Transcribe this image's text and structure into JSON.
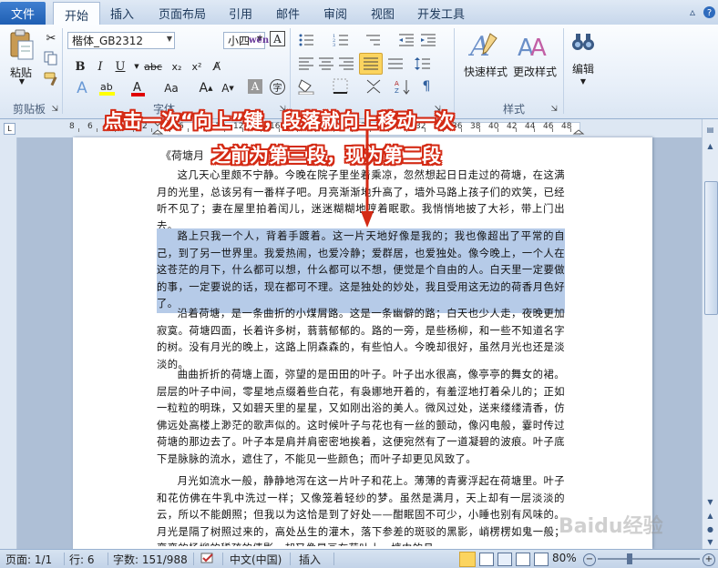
{
  "tabs": {
    "file": "文件",
    "items": [
      "开始",
      "插入",
      "页面布局",
      "引用",
      "邮件",
      "审阅",
      "视图",
      "开发工具"
    ],
    "active": 0
  },
  "ribbon": {
    "clipboard": {
      "paste": "粘贴",
      "label": "剪贴板"
    },
    "font": {
      "name": "楷体_GB2312",
      "size": "小四",
      "label": "字体"
    },
    "styles": {
      "quick": "快速样式",
      "change": "更改样式",
      "label": "样式"
    },
    "editing": {
      "label": "编辑"
    }
  },
  "annotation": {
    "line1": "点击一次“向上”键，段落就向上移动一次",
    "line2": "之前为第三段，现为第二段",
    "color": "#d42a14"
  },
  "ruler_numbers": [
    "8",
    "6",
    "4",
    "2",
    "2",
    "4",
    "6",
    "8",
    "10",
    "12",
    "14",
    "16",
    "18",
    "20",
    "22",
    "24",
    "26",
    "28",
    "30",
    "32",
    "34",
    "36",
    "38",
    "40",
    "42",
    "44",
    "46",
    "48"
  ],
  "document": {
    "title": "《荷塘月",
    "paragraphs": [
      {
        "text": "这几天心里颇不宁静。今晚在院子里坐着乘凉，忽然想起日日走过的荷塘，在这满月的光里，总该另有一番样子吧。月亮渐渐地升高了，墙外马路上孩子们的欢笑，已经听不见了；妻在屋里拍着闰儿，迷迷糊糊地哼着眠歌。我悄悄地披了大衫，带上门出去。"
      },
      {
        "text": "路上只我一个人，背着手踱着。这一片天地好像是我的；我也像超出了平常的自己，到了另一世界里。我爱热闹，也爱冷静；爱群居，也爱独处。像今晚上，一个人在这苍茫的月下，什么都可以想，什么都可以不想，便觉是个自由的人。白天里一定要做的事，一定要说的话，现在都可不理。这是独处的妙处，我且受用这无边的荷香月色好了。"
      },
      {
        "text": "沿着荷塘，是一条曲折的小煤屑路。这是一条幽僻的路；白天也少人走，夜晚更加寂寞。荷塘四面，长着许多树，蓊蓊郁郁的。路的一旁，是些杨柳，和一些不知道名字的树。没有月光的晚上，这路上阴森森的，有些怕人。今晚却很好，虽然月光也还是淡淡的。"
      },
      {
        "text": "曲曲折折的荷塘上面，弥望的是田田的叶子。叶子出水很高，像亭亭的舞女的裙。层层的叶子中间，零星地点缀着些白花，有袅娜地开着的，有羞涩地打着朵儿的；正如一粒粒的明珠，又如碧天里的星星，又如刚出浴的美人。微风过处，送来缕缕清香，仿佛远处高楼上渺茫的歌声似的。这时候叶子与花也有一丝的颤动，像闪电般，霎时传过荷塘的那边去了。叶子本是肩并肩密密地挨着，这便宛然有了一道凝碧的波痕。叶子底下是脉脉的流水，遮住了，不能见一些颜色；而叶子却更见风致了。"
      },
      {
        "text": "月光如流水一般，静静地泻在这一片叶子和花上。薄薄的青雾浮起在荷塘里。叶子和花仿佛在牛乳中洗过一样；又像笼着轻纱的梦。虽然是满月，天上却有一层淡淡的云，所以不能朗照；但我以为这恰是到了好处——酣眠固不可少，小睡也别有风味的。月光是隔了树照过来的，高处丛生的灌木，落下参差的斑驳的黑影，峭楞楞如鬼一般；弯弯的杨柳的稀疏的倩影，却又像是画在荷叶上。塘中的月"
      }
    ]
  },
  "status": {
    "page": "页面: 1/1",
    "line": "行: 6",
    "words": "字数: 151/988",
    "lang": "中文(中国)",
    "mode": "插入",
    "zoom": "80%"
  },
  "watermark": "Baidu经验"
}
